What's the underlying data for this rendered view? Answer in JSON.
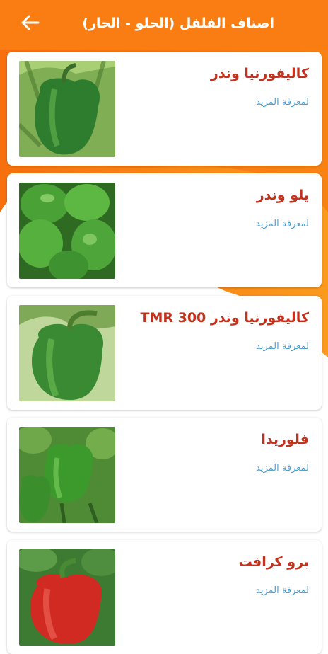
{
  "header": {
    "title": "اصناف الفلفل (الحلو - الحار)",
    "back_icon": "arrow-left-icon"
  },
  "colors": {
    "header_orange": "#f97d12",
    "background_orange": "#fb8c16",
    "product_name": "#c4321d",
    "link_blue": "#4a9fd2",
    "card_bg": "#ffffff"
  },
  "items": [
    {
      "name": "كاليفورنيا وندر",
      "more": "لمعرفة المزيد",
      "pepper_color": "green"
    },
    {
      "name": "يلو وندر",
      "more": "لمعرفة المزيد",
      "pepper_color": "green"
    },
    {
      "name": "كاليفورنيا وندر TMR 300",
      "more": "لمعرفة المزيد",
      "pepper_color": "green"
    },
    {
      "name": "فلوريدا",
      "more": "لمعرفة المزيد",
      "pepper_color": "green"
    },
    {
      "name": "برو كرافت",
      "more": "لمعرفة المزيد",
      "pepper_color": "red"
    }
  ]
}
